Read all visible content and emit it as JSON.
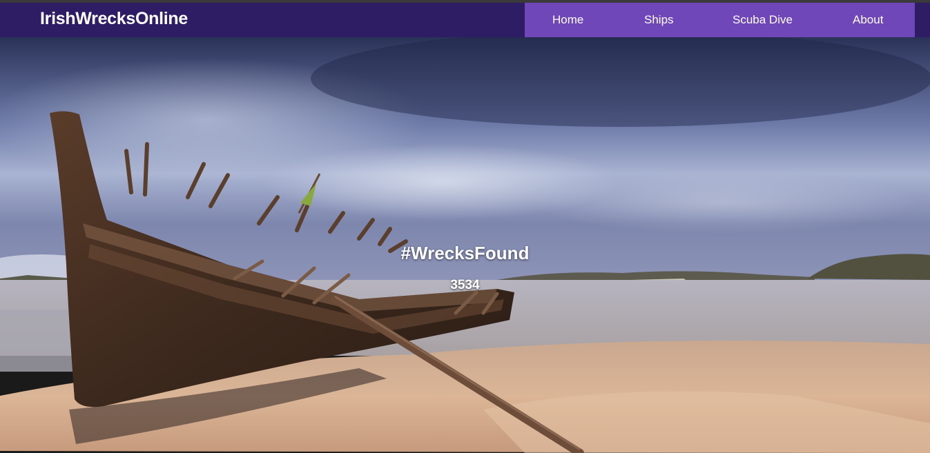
{
  "header": {
    "brand": "IrishWrecksOnline"
  },
  "nav": {
    "items": [
      {
        "label": "Home"
      },
      {
        "label": "Ships"
      },
      {
        "label": "Scuba Dive"
      },
      {
        "label": "About"
      }
    ]
  },
  "hero": {
    "title": "#WrecksFound",
    "count": "3534"
  },
  "colors": {
    "navbar_bg": "#2e1c64",
    "nav_menu_bg": "#6f47b8",
    "text": "#ffffff"
  }
}
